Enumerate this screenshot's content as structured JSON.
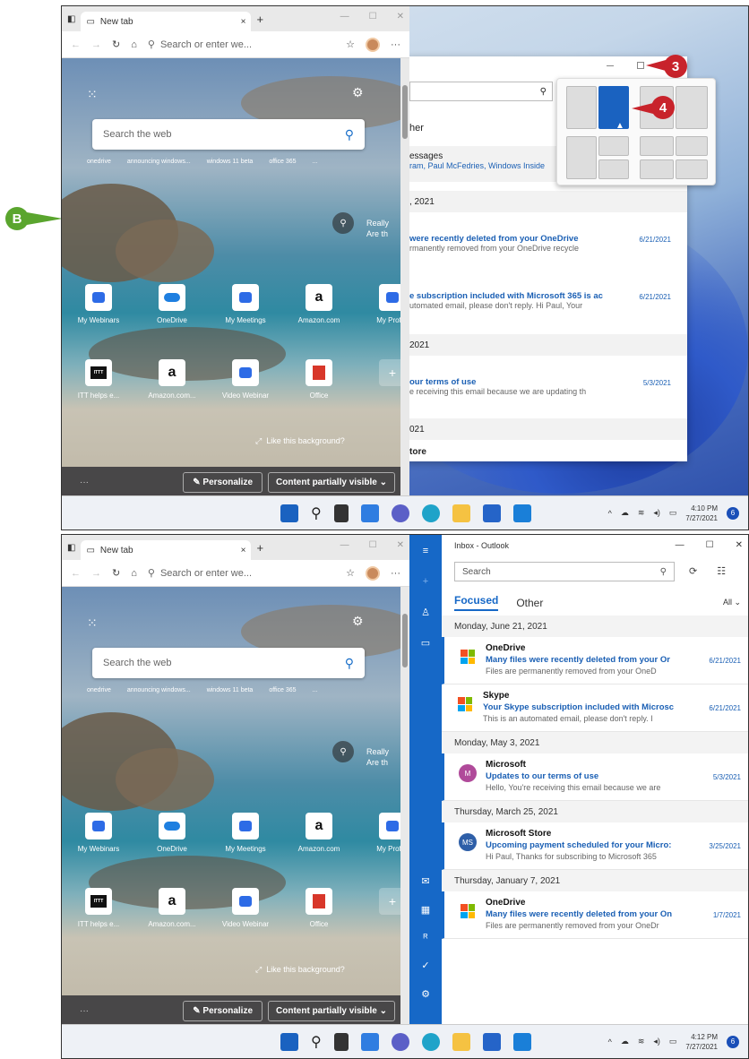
{
  "callouts": {
    "b": "B",
    "three": "3",
    "four": "4"
  },
  "edge": {
    "tab_title": "New tab",
    "tab_close": "×",
    "new_tab": "+",
    "address_placeholder": "Search or enter we...",
    "search_placeholder": "Search the web",
    "quick_links": [
      "onedrive",
      "announcing windows...",
      "windows 11 beta",
      "office 365",
      "..."
    ],
    "news_prefix": "Really",
    "news_line2": "Are th",
    "tiles_row1": [
      "My Webinars",
      "OneDrive",
      "My Meetings",
      "Amazon.com",
      "My Profile"
    ],
    "tiles_row2": [
      "ITT helps e...",
      "Amazon.com...",
      "Video Webinar",
      "Office",
      ""
    ],
    "like_bg": "Like this background?",
    "bottom_dots": "···",
    "personalize": "Personalize",
    "content_visible": "Content partially visible"
  },
  "mail1": {
    "tab_fragment": "her",
    "group1_line1": "essages",
    "group1_line2": "ram, Paul McFedries, Windows Inside",
    "hdr1": ", 2021",
    "m1_subj": "were recently deleted from your OneDrive",
    "m1_prev": "rmanently removed from your OneDrive recycle",
    "m1_date": "6/21/2021",
    "m2_subj": "e subscription included with Microsoft 365 is ac",
    "m2_prev": "utomated email, please don't reply. Hi Paul, Your",
    "m2_date": "6/21/2021",
    "hdr2": "2021",
    "m3_subj": "our terms of use",
    "m3_prev": "e receiving this email because we are updating th",
    "m3_date": "5/3/2021",
    "hdr3": "021",
    "store_fragment": "tore"
  },
  "taskbar": {
    "time1": "4:10 PM",
    "date1": "7/27/2021",
    "time2": "4:12 PM",
    "date2": "7/27/2021",
    "notif": "6"
  },
  "outlook": {
    "title": "Inbox - Outlook",
    "search": "Search",
    "tab_focused": "Focused",
    "tab_other": "Other",
    "filter": "All",
    "groups": [
      {
        "header": "Monday, June 21, 2021",
        "messages": [
          {
            "sender": "OneDrive",
            "subject": "Many files were recently deleted from your Or",
            "preview": "Files are permanently removed from your OneD",
            "date": "6/21/2021"
          },
          {
            "sender": "Skype",
            "subject": "Your Skype subscription included with Microsc",
            "preview": "This is an automated email, please don't reply. I",
            "date": "6/21/2021"
          }
        ]
      },
      {
        "header": "Monday, May 3, 2021",
        "messages": [
          {
            "sender": "Microsoft",
            "subject": "Updates to our terms of use",
            "preview": "Hello, You're receiving this email because we are",
            "date": "5/3/2021",
            "avatar": "M"
          }
        ]
      },
      {
        "header": "Thursday, March 25, 2021",
        "messages": [
          {
            "sender": "Microsoft Store",
            "subject": "Upcoming payment scheduled for your Micro:",
            "preview": "Hi Paul, Thanks for subscribing to Microsoft 365",
            "date": "3/25/2021",
            "avatar": "MS"
          }
        ]
      },
      {
        "header": "Thursday, January 7, 2021",
        "messages": [
          {
            "sender": "OneDrive",
            "subject": "Many files were recently deleted from your On",
            "preview": "Files are permanently removed from your OneDr",
            "date": "1/7/2021"
          }
        ]
      }
    ]
  },
  "colors": {
    "accent": "#1668c7",
    "callout_red": "#c8232b",
    "callout_green": "#5aa52e"
  }
}
